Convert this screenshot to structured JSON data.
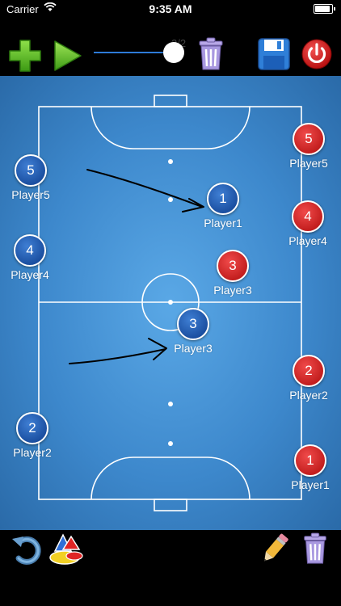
{
  "status": {
    "carrier": "Carrier",
    "time": "9:35 AM"
  },
  "toolbar": {
    "icons": [
      "plus-icon",
      "play-icon",
      "trash-icon",
      "save-icon",
      "power-icon"
    ],
    "frame_counter": "2/2",
    "timeline_position": 1.0
  },
  "colors": {
    "team_blue": "#0c3c8c",
    "team_red": "#c41010",
    "field": "#3d88cc",
    "line": "#ffffff"
  },
  "players": [
    {
      "team": "blue",
      "number": "5",
      "name": "Player5"
    },
    {
      "team": "blue",
      "number": "1",
      "name": "Player1"
    },
    {
      "team": "blue",
      "number": "4",
      "name": "Player4"
    },
    {
      "team": "blue",
      "number": "3",
      "name": "Player3"
    },
    {
      "team": "blue",
      "number": "2",
      "name": "Player2"
    },
    {
      "team": "red",
      "number": "5",
      "name": "Player5"
    },
    {
      "team": "red",
      "number": "4",
      "name": "Player4"
    },
    {
      "team": "red",
      "number": "3",
      "name": "Player3"
    },
    {
      "team": "red",
      "number": "2",
      "name": "Player2"
    },
    {
      "team": "red",
      "number": "1",
      "name": "Player1"
    }
  ],
  "bottom": {
    "icons": [
      "undo-icon",
      "color-picker-icon",
      "pencil-icon",
      "trash-icon"
    ]
  }
}
